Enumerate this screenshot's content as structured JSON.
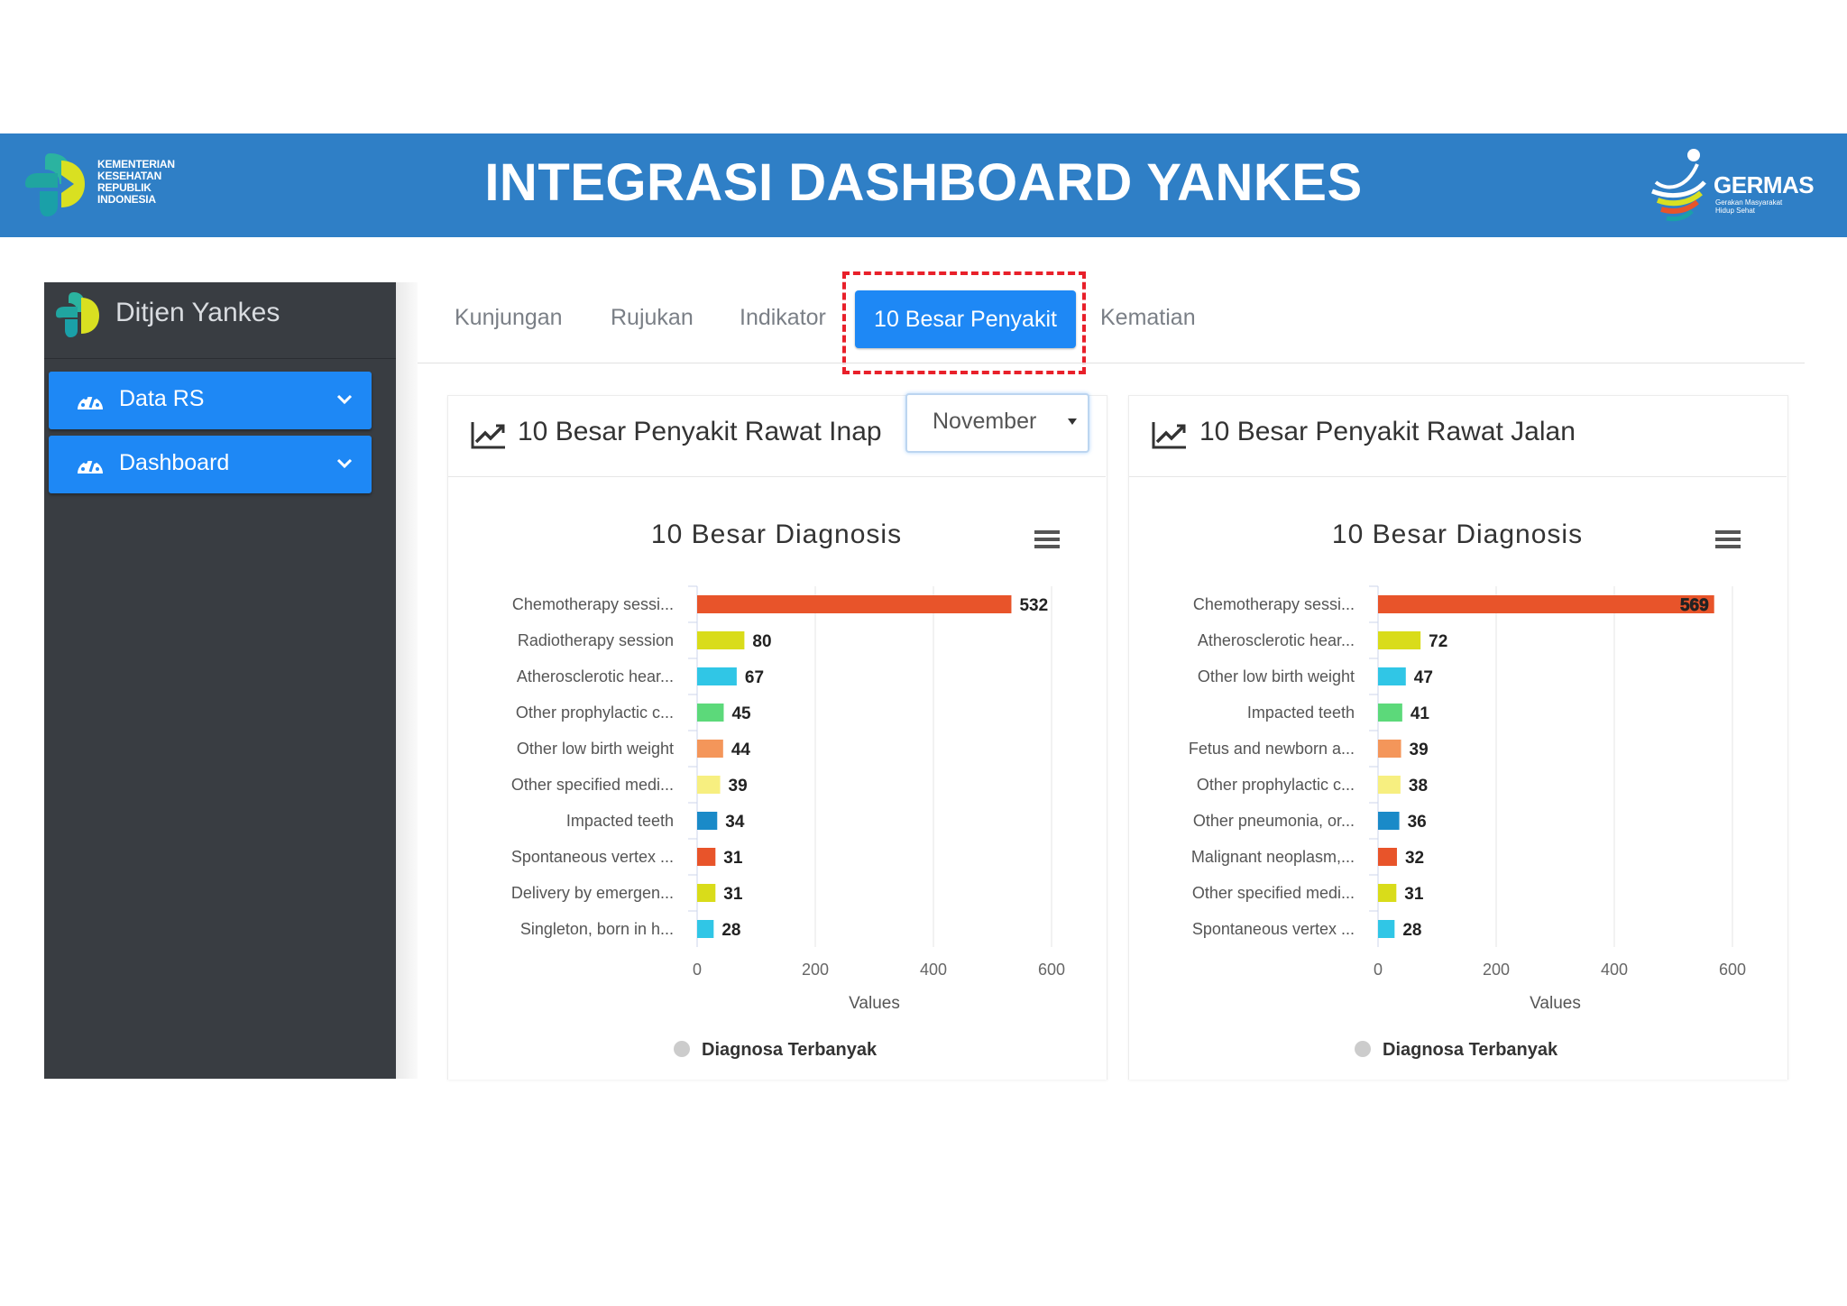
{
  "banner": {
    "title": "INTEGRASI DASHBOARD YANKES",
    "org_lines": [
      "KEMENTERIAN",
      "KESEHATAN",
      "REPUBLIK",
      "INDONESIA"
    ],
    "germas": "GERMAS",
    "germas_sub": "Gerakan Masyarakat Hidup Sehat",
    "colors": {
      "banner": "#2f7fc6"
    }
  },
  "sidebar": {
    "brand": "Ditjen Yankes",
    "items": [
      {
        "label": "Data RS",
        "icon": "dashboard-gauge-icon"
      },
      {
        "label": "Dashboard",
        "icon": "dashboard-gauge-icon"
      }
    ]
  },
  "tabs": [
    {
      "label": "Kunjungan",
      "active": false
    },
    {
      "label": "Rujukan",
      "active": false
    },
    {
      "label": "Indikator",
      "active": false
    },
    {
      "label": "10 Besar Penyakit",
      "active": true
    },
    {
      "label": "Kematian",
      "active": false
    }
  ],
  "filter": {
    "month": "November"
  },
  "panels": [
    {
      "title": "10 Besar Penyakit Rawat Inap"
    },
    {
      "title": "10 Besar Penyakit Rawat Jalan"
    }
  ],
  "chart_data": [
    {
      "type": "bar",
      "orientation": "horizontal",
      "title": "10 Besar Diagnosis",
      "xlabel": "Values",
      "ylabel": "",
      "xlim": [
        0,
        600
      ],
      "ticks": [
        0,
        200,
        400,
        600
      ],
      "grid": true,
      "legend": "bottom-center",
      "series": [
        {
          "name": "Diagnosa Terbanyak"
        }
      ],
      "categories": [
        "Chemotherapy sessi...",
        "Radiotherapy session",
        "Atherosclerotic hear...",
        "Other prophylactic c...",
        "Other low birth weight",
        "Other specified medi...",
        "Impacted teeth",
        "Spontaneous vertex ...",
        "Delivery by emergen...",
        "Singleton, born in h..."
      ],
      "values": [
        532,
        80,
        67,
        45,
        44,
        39,
        34,
        31,
        31,
        28
      ],
      "colors": [
        "#e8542a",
        "#d9dc1a",
        "#30c6e6",
        "#5cd97a",
        "#f4965a",
        "#f7ef80",
        "#1a8ac8",
        "#e8542a",
        "#d9dc1a",
        "#30c6e6"
      ]
    },
    {
      "type": "bar",
      "orientation": "horizontal",
      "title": "10 Besar Diagnosis",
      "xlabel": "Values",
      "ylabel": "",
      "xlim": [
        0,
        600
      ],
      "ticks": [
        0,
        200,
        400,
        600
      ],
      "grid": true,
      "legend": "bottom-center",
      "series": [
        {
          "name": "Diagnosa Terbanyak"
        }
      ],
      "categories": [
        "Chemotherapy sessi...",
        "Atherosclerotic hear...",
        "Other low birth weight",
        "Impacted teeth",
        "Fetus and newborn a...",
        "Other prophylactic c...",
        "Other pneumonia, or...",
        "Malignant neoplasm,...",
        "Other specified medi...",
        "Spontaneous vertex ..."
      ],
      "values": [
        569,
        72,
        47,
        41,
        39,
        38,
        36,
        32,
        31,
        28
      ],
      "colors": [
        "#e8542a",
        "#d9dc1a",
        "#30c6e6",
        "#5cd97a",
        "#f4965a",
        "#f7ef80",
        "#1a8ac8",
        "#e8542a",
        "#d9dc1a",
        "#30c6e6"
      ]
    }
  ]
}
